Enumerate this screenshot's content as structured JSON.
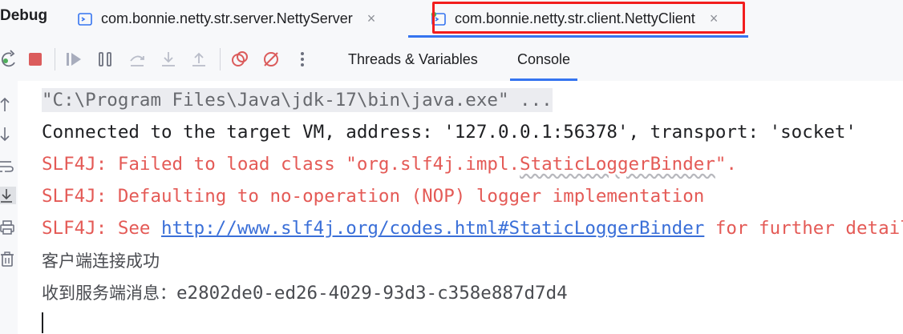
{
  "header": {
    "title": "Debug",
    "tabs": [
      {
        "label": "com.bonnie.netty.str.server.NettyServer",
        "close": "×"
      },
      {
        "label": "com.bonnie.netty.str.client.NettyClient",
        "close": "×"
      }
    ]
  },
  "toolbar": {
    "view_tabs": [
      "Threads & Variables",
      "Console"
    ],
    "active_view": "Console"
  },
  "console": {
    "cmd_line": "\"C:\\Program Files\\Java\\jdk-17\\bin\\java.exe\" ...",
    "connected_line": "Connected to the target VM, address: '127.0.0.1:56378', transport: 'socket'",
    "err1_prefix": "SLF4J: Failed to load class \"org.slf4j.impl.",
    "err1_word": "StaticLoggerBinder",
    "err1_suffix": "\".",
    "err2": "SLF4J: Defaulting to no-operation (NOP) logger implementation",
    "err3_prefix": "SLF4J: See ",
    "err3_link": "http://www.slf4j.org/codes.html#StaticLoggerBinder",
    "err3_suffix": " for further details.",
    "msg1": "客户端连接成功",
    "msg2_prefix": "收到服务端消息：",
    "msg2_value": "e2802de0-ed26-4029-93d3-c358e887d7d4"
  },
  "colors": {
    "accent": "#3574f0",
    "error_text": "#e45a56",
    "highlight_box": "#f21d1d",
    "link": "#3a6fd8",
    "run_badge": "#4fae5b"
  }
}
